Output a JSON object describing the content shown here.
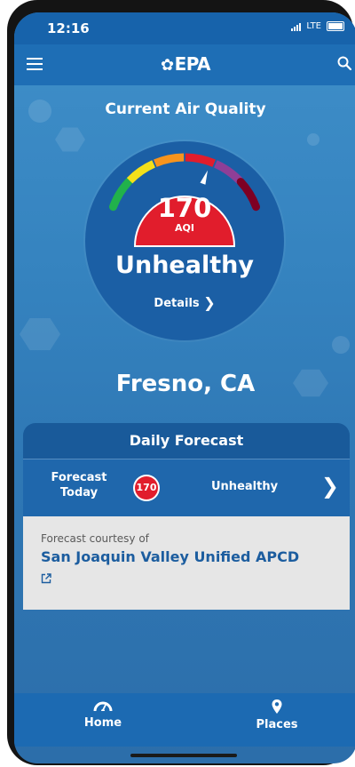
{
  "status_bar": {
    "time": "12:16",
    "network": "LTE"
  },
  "app_bar": {
    "logo_text": "EPA",
    "logo_mark": "✿"
  },
  "gauge": {
    "heading": "Current Air Quality",
    "aqi_value": "170",
    "aqi_label": "AQI",
    "category": "Unhealthy",
    "details_label": "Details",
    "badge_color": "#e11d2c",
    "segment_colors": [
      "#21b24b",
      "#f4e01a",
      "#f7941d",
      "#e11d2c",
      "#8f3f97",
      "#7e0023"
    ]
  },
  "location": {
    "city": "Fresno, CA"
  },
  "forecast": {
    "header": "Daily Forecast",
    "row_label_line1": "Forecast",
    "row_label_line2": "Today",
    "aqi_badge": "170",
    "status": "Unhealthy",
    "credit_label": "Forecast courtesy of",
    "credit_source": "San Joaquin Valley Unified APCD"
  },
  "tabs": [
    {
      "label": "Home",
      "icon": "gauge-icon"
    },
    {
      "label": "Places",
      "icon": "location-pin-icon"
    }
  ]
}
